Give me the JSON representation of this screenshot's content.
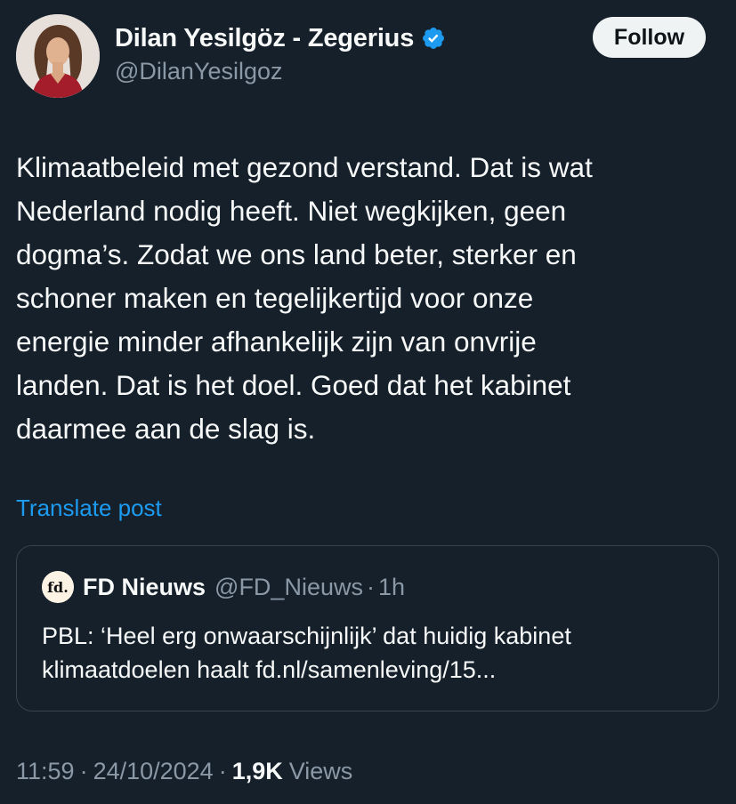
{
  "author": {
    "display_name": "Dilan Yesilgöz - Zegerius",
    "handle": "@DilanYesilgoz",
    "verified": true,
    "verified_icon": "verified-badge-icon",
    "avatar": "profile-photo"
  },
  "follow_label": "Follow",
  "tweet": {
    "lines": [
      "Klimaatbeleid met gezond verstand. Dat is wat",
      "Nederland nodig heeft. Niet wegkijken, geen",
      "dogma’s. Zodat we ons land beter, sterker en",
      "schoner maken en tegelijkertijd voor onze",
      "energie minder afhankelijk zijn van onvrije",
      "landen. Dat is het doel. Goed dat het kabinet",
      "daarmee aan de slag is."
    ]
  },
  "translate_label": "Translate post",
  "quote": {
    "avatar_text": "fd.",
    "name": "FD Nieuws",
    "handle": "@FD_Nieuws",
    "dot": "·",
    "time": "1h",
    "lines": [
      "PBL: ‘Heel erg onwaarschijnlijk’ dat huidig kabinet",
      "klimaatdoelen haalt fd.nl/samenleving/15..."
    ]
  },
  "meta": {
    "time": "11:59",
    "sep": "·",
    "date": "24/10/2024",
    "views_count": "1,9K",
    "views_label": "Views"
  },
  "colors": {
    "background": "#15202b",
    "text": "#f7f9f9",
    "secondary": "#8b98a5",
    "link": "#1d9bf0",
    "border": "#38444d",
    "verified": "#1d9bf0"
  }
}
